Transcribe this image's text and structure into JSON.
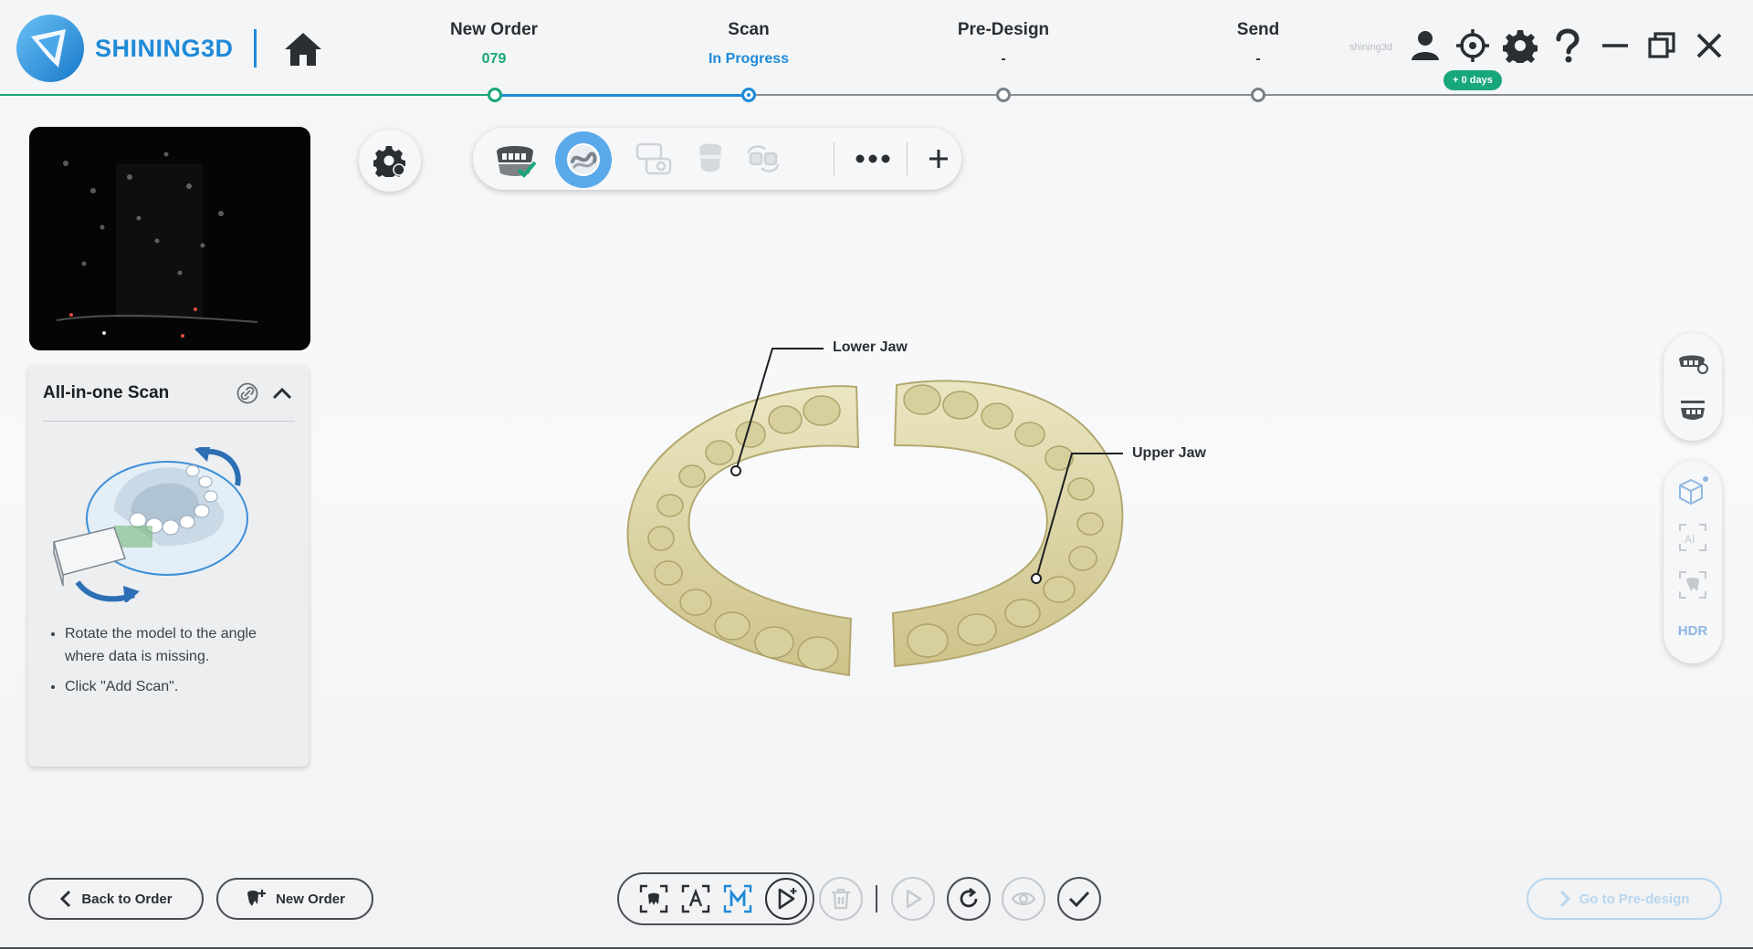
{
  "brand": {
    "name": "SHINING3D"
  },
  "steps": [
    {
      "title": "New Order",
      "sub": "079",
      "state": "done"
    },
    {
      "title": "Scan",
      "sub": "In Progress",
      "state": "active"
    },
    {
      "title": "Pre-Design",
      "sub": "-",
      "state": "pending"
    },
    {
      "title": "Send",
      "sub": "-",
      "state": "pending"
    }
  ],
  "header": {
    "user_name": "shining3d",
    "days_badge": "+ 0 days",
    "icons": [
      "user-icon",
      "target-icon",
      "gear-icon",
      "help-icon",
      "minimize-icon",
      "restore-icon",
      "close-icon"
    ]
  },
  "scan_card": {
    "title": "All-in-one Scan",
    "tips": [
      "Rotate the model to the angle where data is missing.",
      "Click \"Add Scan\"."
    ]
  },
  "toolbar": {
    "icons": [
      "jaw-check-icon",
      "all-in-one-scan-icon",
      "pre-op-scan-icon",
      "tooth-scan-icon",
      "bite-scan-icon",
      "more-icon",
      "add-icon"
    ]
  },
  "model": {
    "lower_jaw_label": "Lower Jaw",
    "upper_jaw_label": "Upper Jaw",
    "color": "#e3dcad"
  },
  "side_panel": {
    "hdr_label": "HDR",
    "ai_label": "AI"
  },
  "bottom": {
    "back_label": "Back to Order",
    "new_order_label": "New Order",
    "go_predesign_label": "Go to Pre-design"
  },
  "colors": {
    "accent": "#1f8ad8",
    "done": "#18a77a",
    "disabled": "#b8d6ee"
  }
}
